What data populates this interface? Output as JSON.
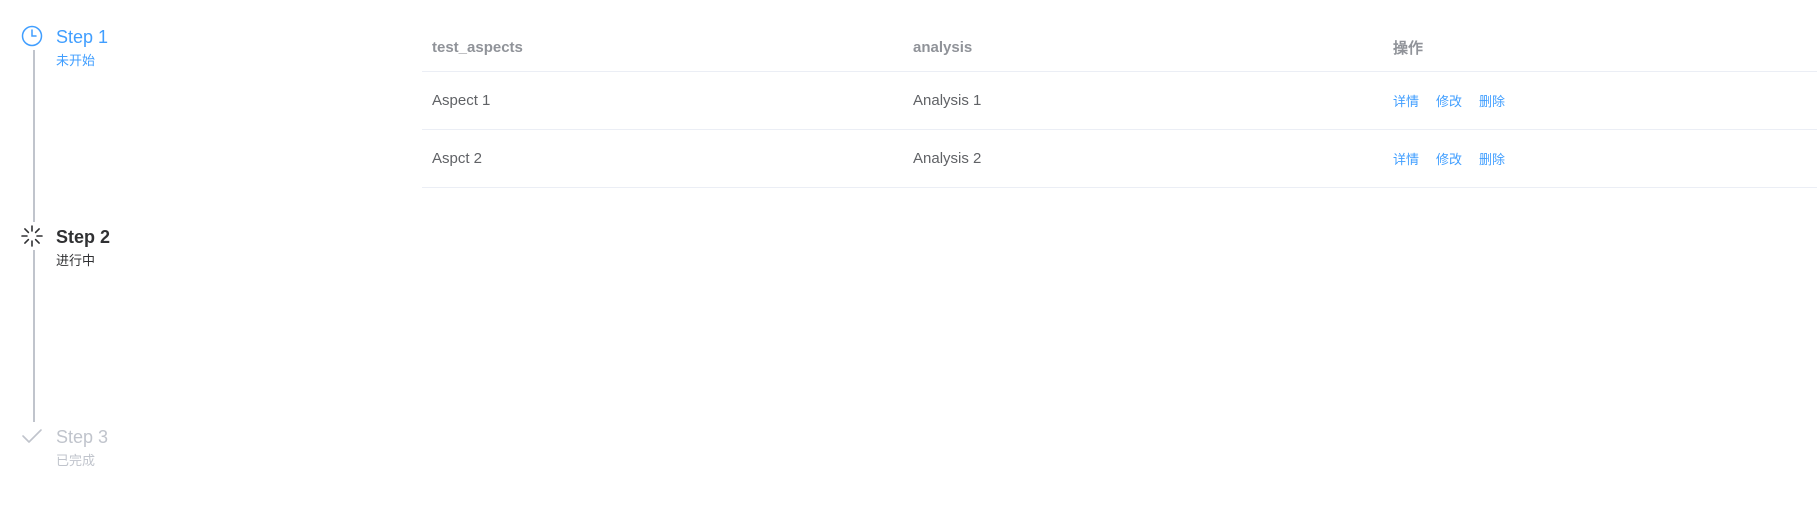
{
  "steps": [
    {
      "title": "Step 1",
      "description": "未开始",
      "status": "wait",
      "icon": "clock-icon",
      "color": "#409eff"
    },
    {
      "title": "Step 2",
      "description": "进行中",
      "status": "process",
      "icon": "loading-icon",
      "color": "#303133"
    },
    {
      "title": "Step 3",
      "description": "已完成",
      "status": "finish",
      "icon": "check-icon",
      "color": "#c0c4cc"
    }
  ],
  "table": {
    "columns": [
      "test_aspects",
      "analysis",
      "操作"
    ],
    "rows": [
      {
        "test_aspects": "Aspect 1",
        "analysis": "Analysis 1"
      },
      {
        "test_aspects": "Aspct 2",
        "analysis": "Analysis 2"
      }
    ],
    "actions": {
      "detail": "详情",
      "edit": "修改",
      "delete": "删除"
    }
  },
  "colors": {
    "primary": "#409eff",
    "text_regular": "#606266",
    "text_header": "#909399",
    "border": "#ebeef5",
    "disabled": "#c0c4cc"
  }
}
